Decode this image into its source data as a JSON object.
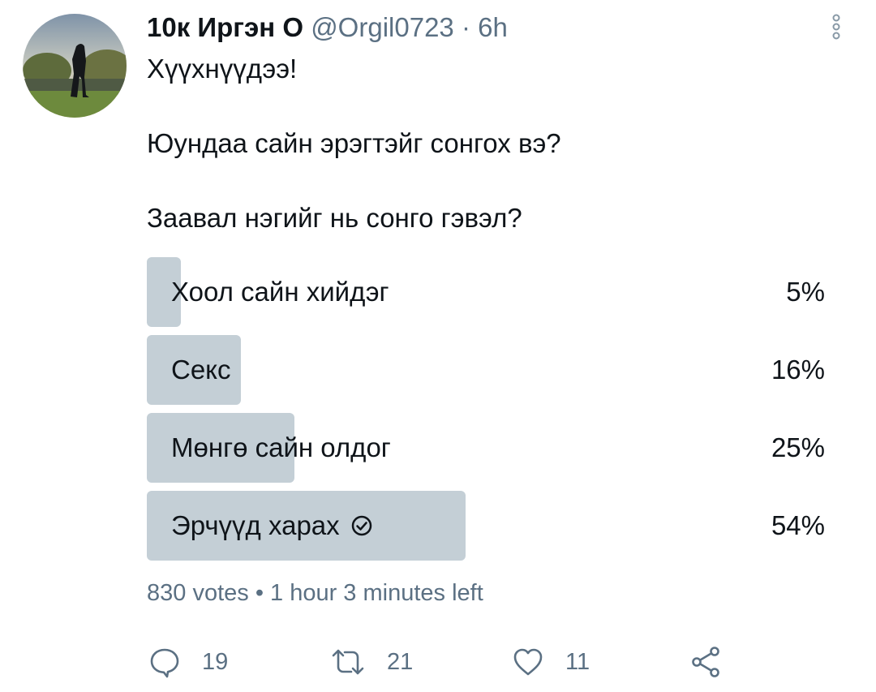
{
  "tweet": {
    "author_name": "10к Иргэн О",
    "handle": "@Orgil0723",
    "separator": "·",
    "time": "6h",
    "text": "Хүүхнүүдээ!\n\nЮундаа сайн эрэгтэйг сонгох вэ?\n\nЗаавал нэгийг нь сонго гэвэл?"
  },
  "poll": {
    "options": [
      {
        "label": "Хоол сайн хийдэг",
        "percent_label": "5%",
        "percent": 5,
        "selected": false
      },
      {
        "label": "Секс",
        "percent_label": "16%",
        "percent": 16,
        "selected": false
      },
      {
        "label": "Мөнгө сайн олдог",
        "percent_label": "25%",
        "percent": 25,
        "selected": false
      },
      {
        "label": "Эрчүүд харах",
        "percent_label": "54%",
        "percent": 54,
        "selected": true
      }
    ],
    "meta": "830 votes • 1 hour 3 minutes left"
  },
  "actions": {
    "reply_count": "19",
    "retweet_count": "21",
    "like_count": "11"
  },
  "colors": {
    "poll_bar": "#c4cfd6",
    "secondary_text": "#5b7083",
    "primary_text": "#0f1419"
  }
}
